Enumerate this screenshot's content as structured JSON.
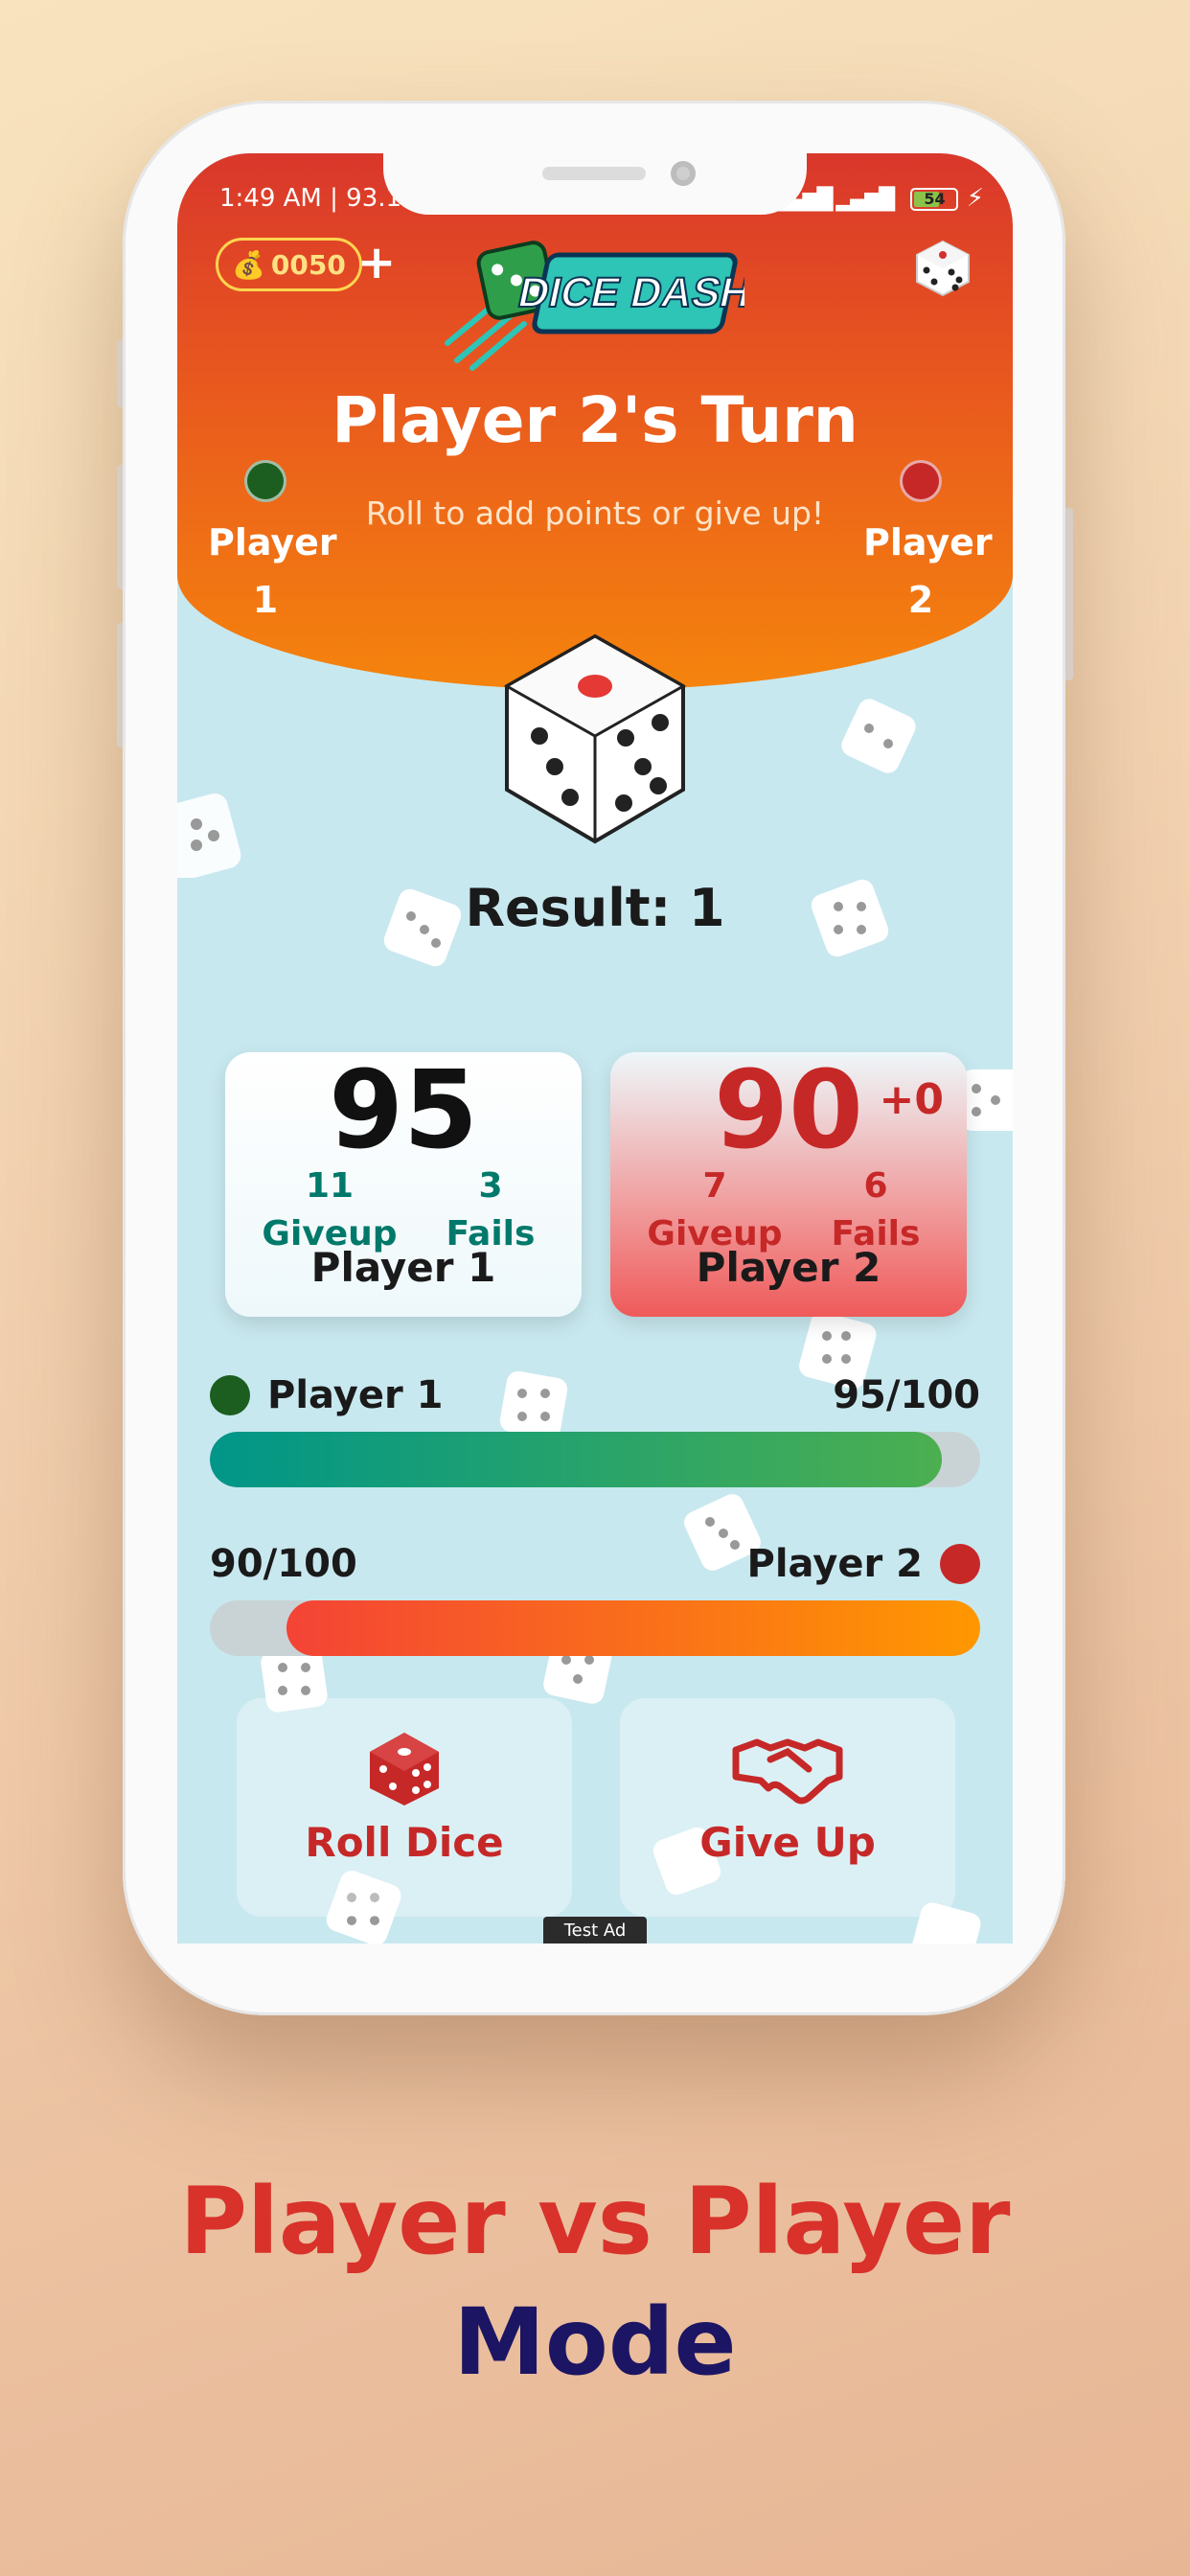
{
  "status_bar": {
    "time": "1:49 AM | 93.1",
    "signal": "▂▄▆█ ▂▄▆█",
    "battery": "54"
  },
  "header": {
    "coins": "0050",
    "add_coins": "+",
    "turn_title": "Player 2's Turn",
    "turn_subtitle": "Roll to add points or give up!",
    "player1_label": "Player 1",
    "player2_label": "Player 2",
    "player1_color": "#1b5e20",
    "player2_color": "#c62828"
  },
  "result": {
    "label": "Result: 1",
    "die_face": 1
  },
  "cards": [
    {
      "score": "95",
      "delta": "",
      "giveup_count": "11",
      "giveup_label": "Giveup",
      "fails_count": "3",
      "fails_label": "Fails",
      "name": "Player 1"
    },
    {
      "score": "90",
      "delta": "+0",
      "giveup_count": "7",
      "giveup_label": "Giveup",
      "fails_count": "6",
      "fails_label": "Fails",
      "name": "Player 2"
    }
  ],
  "progress": [
    {
      "name": "Player 1",
      "value_text": "95/100",
      "value": 95,
      "max": 100,
      "color": "#1b5e20"
    },
    {
      "name": "Player 2",
      "value_text": "90/100",
      "value": 90,
      "max": 100,
      "color": "#c62828"
    }
  ],
  "actions": {
    "roll_label": "Roll Dice",
    "giveup_label": "Give Up"
  },
  "ad_label": "Test Ad",
  "caption": {
    "line1": "Player vs Player",
    "line2": "Mode"
  },
  "colors": {
    "accent_red": "#d8322a",
    "caption_navy": "#1c1564",
    "teal_text": "#00796b"
  }
}
